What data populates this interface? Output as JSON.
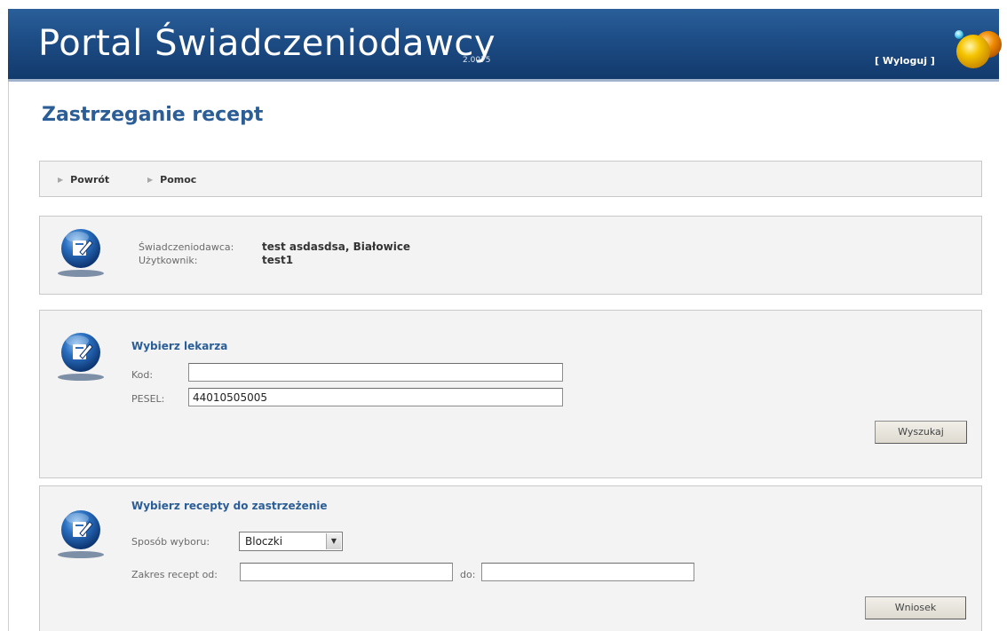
{
  "header": {
    "title": "Portal Świadczeniodawcy",
    "version": "2.0075",
    "logout_label": "[ Wyloguj ]"
  },
  "page": {
    "title": "Zastrzeganie recept"
  },
  "nav": {
    "back_label": "Powrót",
    "help_label": "Pomoc"
  },
  "info": {
    "provider_label": "Świadczeniodawca:",
    "provider_value": "test asdasdsa, Białowice",
    "user_label": "Użytkownik:",
    "user_value": "test1"
  },
  "doctor_form": {
    "title": "Wybierz lekarza",
    "code_label": "Kod:",
    "code_value": "",
    "pesel_label": "PESEL:",
    "pesel_value": "44010505005",
    "search_label": "Wyszukaj"
  },
  "prescription_form": {
    "title": "Wybierz recepty do zastrzeżenie",
    "method_label": "Sposób wyboru:",
    "method_value": "Bloczki",
    "range_from_label": "Zakres recept od:",
    "range_from_value": "",
    "range_to_label": "do:",
    "range_to_value": "",
    "submit_label": "Wniosek"
  },
  "colors": {
    "header_blue": "#1d4c85",
    "title_blue": "#2b5e96",
    "panel_bg": "#f3f3f3",
    "logo_yellow": "#f5c400",
    "logo_orange": "#f08a00"
  },
  "icons": {
    "nav_arrow": "triangle-right-icon",
    "orb": "edit-document-icon",
    "select_arrow": "chevron-down-icon"
  }
}
